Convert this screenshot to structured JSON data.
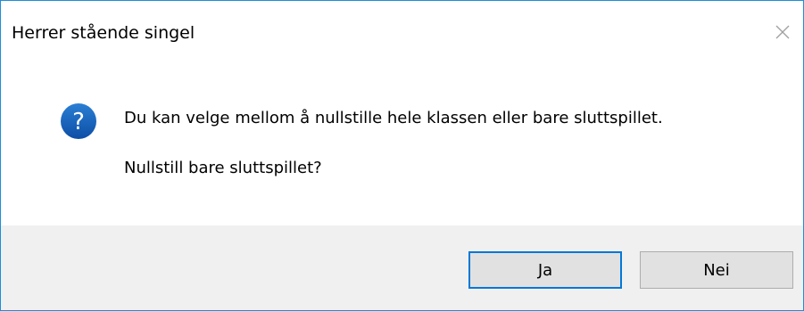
{
  "window": {
    "title": "Herrer stående singel",
    "border_color": "#1c8fd8"
  },
  "titlebar": {
    "close_icon": "close-icon"
  },
  "content": {
    "icon": "question-icon",
    "icon_color": "#1560bd",
    "message_line_1": "Du kan velge mellom å nullstille hele klassen eller bare sluttspillet.",
    "message_line_2": "Nullstill bare sluttspillet?"
  },
  "buttons": {
    "yes_label": "Ja",
    "no_label": "Nei",
    "default": "yes",
    "focus_color": "#0078d7"
  }
}
